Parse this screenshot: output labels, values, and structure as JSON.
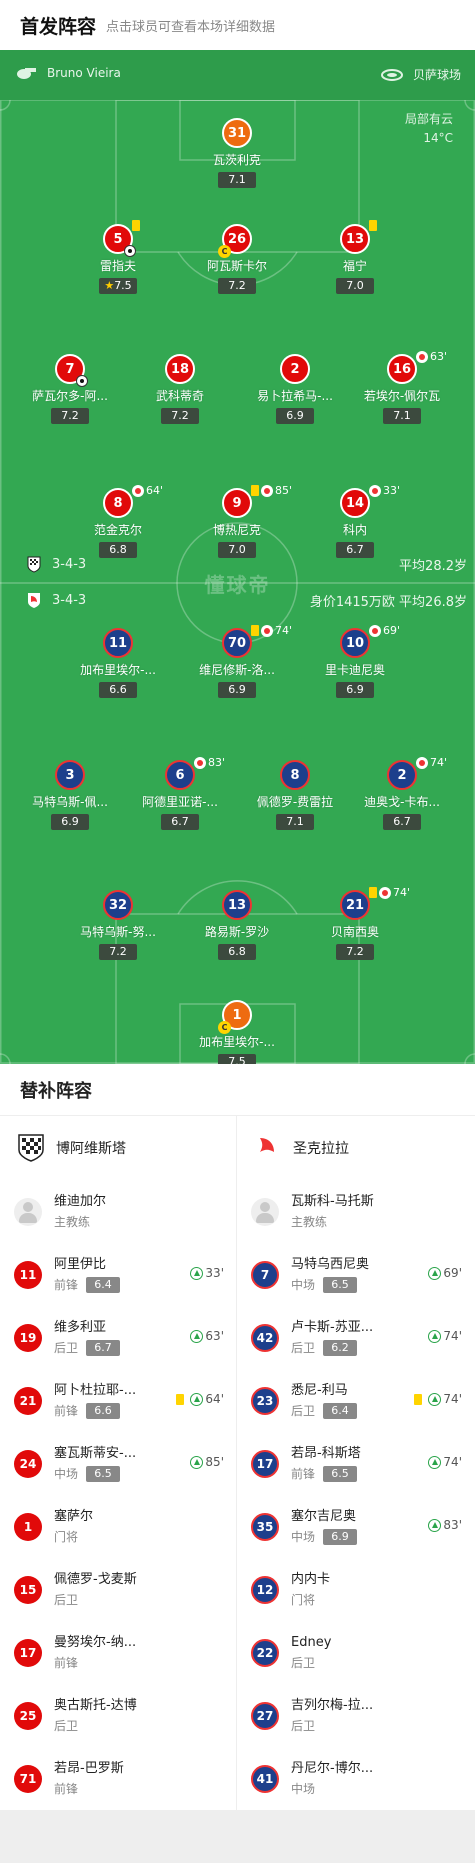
{
  "header": {
    "title": "首发阵容",
    "subtitle": "点击球员可查看本场详细数据"
  },
  "pitch": {
    "referee": "Bruno Vieira",
    "venue": "贝萨球场",
    "weather": {
      "desc": "局部有云",
      "temp": "14°C"
    },
    "watermark": "懂球帝",
    "home": {
      "formation": "3-4-3",
      "meta": "平均28.2岁"
    },
    "away": {
      "formation": "3-4-3",
      "meta": "身价1415万欧 平均26.8岁"
    },
    "home_players": [
      {
        "num": "31",
        "name": "瓦茨利克",
        "rating": "7.1",
        "gk": true
      },
      {
        "num": "5",
        "name": "雷指夫",
        "rating": "7.5",
        "star": true,
        "yellow": true,
        "goal": true
      },
      {
        "num": "26",
        "name": "阿瓦斯卡尔",
        "rating": "7.2",
        "captain": true
      },
      {
        "num": "13",
        "name": "福宁",
        "rating": "7.0",
        "yellow": true
      },
      {
        "num": "7",
        "name": "萨瓦尔多-阿...",
        "rating": "7.2",
        "ball": true
      },
      {
        "num": "18",
        "name": "武科蒂奇",
        "rating": "7.2"
      },
      {
        "num": "2",
        "name": "易卜拉希马-...",
        "rating": "6.9"
      },
      {
        "num": "16",
        "name": "若埃尔-佩尔瓦",
        "rating": "7.1",
        "sub": "63'"
      },
      {
        "num": "8",
        "name": "范金克尔",
        "rating": "6.8",
        "sub": "64'"
      },
      {
        "num": "9",
        "name": "博热尼克",
        "rating": "7.0",
        "yellow": true,
        "sub": "85'"
      },
      {
        "num": "14",
        "name": "科内",
        "rating": "6.7",
        "sub": "33'"
      }
    ],
    "away_players": [
      {
        "num": "11",
        "name": "加布里埃尔-...",
        "rating": "6.6"
      },
      {
        "num": "70",
        "name": "维尼修斯-洛...",
        "rating": "6.9",
        "yellow": true,
        "sub": "74'"
      },
      {
        "num": "10",
        "name": "里卡迪尼奥",
        "rating": "6.9",
        "sub": "69'"
      },
      {
        "num": "3",
        "name": "马特乌斯-佩...",
        "rating": "6.9"
      },
      {
        "num": "6",
        "name": "阿德里亚诺-...",
        "rating": "6.7",
        "sub": "83'"
      },
      {
        "num": "8",
        "name": "佩德罗-费雷拉",
        "rating": "7.1"
      },
      {
        "num": "2",
        "name": "迪奥戈-卡布...",
        "rating": "6.7",
        "sub": "74'"
      },
      {
        "num": "32",
        "name": "马特乌斯-努...",
        "rating": "7.2"
      },
      {
        "num": "13",
        "name": "路易斯-罗沙",
        "rating": "6.8"
      },
      {
        "num": "21",
        "name": "贝南西奥",
        "rating": "7.2",
        "yellow": true,
        "sub": "74'"
      },
      {
        "num": "1",
        "name": "加布里埃尔-...",
        "rating": "7.5",
        "gk": true,
        "captain": true
      }
    ]
  },
  "subs": {
    "title": "替补阵容",
    "home": {
      "team": "博阿维斯塔",
      "coach": {
        "name": "维迪加尔",
        "role": "主教练"
      },
      "players": [
        {
          "num": "11",
          "name": "阿里伊比",
          "pos": "前锋",
          "rating": "6.4",
          "in": "33'"
        },
        {
          "num": "19",
          "name": "维多利亚",
          "pos": "后卫",
          "rating": "6.7",
          "in": "63'"
        },
        {
          "num": "21",
          "name": "阿卜杜拉耶-...",
          "pos": "前锋",
          "rating": "6.6",
          "in": "64'",
          "yellow": true
        },
        {
          "num": "24",
          "name": "塞瓦斯蒂安-...",
          "pos": "中场",
          "rating": "6.5",
          "in": "85'"
        },
        {
          "num": "1",
          "name": "塞萨尔",
          "pos": "门将"
        },
        {
          "num": "15",
          "name": "佩德罗-戈麦斯",
          "pos": "后卫"
        },
        {
          "num": "17",
          "name": "曼努埃尔-纳...",
          "pos": "前锋"
        },
        {
          "num": "25",
          "name": "奥古斯托-达博",
          "pos": "后卫"
        },
        {
          "num": "71",
          "name": "若昂-巴罗斯",
          "pos": "前锋"
        }
      ]
    },
    "away": {
      "team": "圣克拉拉",
      "coach": {
        "name": "瓦斯科-马托斯",
        "role": "主教练"
      },
      "players": [
        {
          "num": "7",
          "name": "马特乌西尼奥",
          "pos": "中场",
          "rating": "6.5",
          "in": "69'"
        },
        {
          "num": "42",
          "name": "卢卡斯-苏亚...",
          "pos": "后卫",
          "rating": "6.2",
          "in": "74'"
        },
        {
          "num": "23",
          "name": "悉尼-利马",
          "pos": "后卫",
          "rating": "6.4",
          "in": "74'",
          "yellow": true
        },
        {
          "num": "17",
          "name": "若昂-科斯塔",
          "pos": "前锋",
          "rating": "6.5",
          "in": "74'"
        },
        {
          "num": "35",
          "name": "塞尔吉尼奥",
          "pos": "中场",
          "rating": "6.9",
          "in": "83'"
        },
        {
          "num": "12",
          "name": "内内卡",
          "pos": "门将"
        },
        {
          "num": "22",
          "name": "Edney",
          "pos": "后卫"
        },
        {
          "num": "27",
          "name": "吉列尔梅-拉...",
          "pos": "后卫"
        },
        {
          "num": "41",
          "name": "丹尼尔-博尔...",
          "pos": "中场"
        }
      ]
    }
  }
}
